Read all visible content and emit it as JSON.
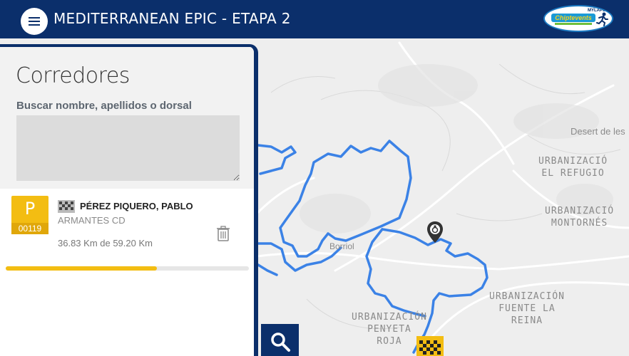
{
  "header": {
    "title": "MEDITERRANEAN EPIC - ETAPA 2",
    "menu_icon": "hamburger-menu-icon",
    "logo": {
      "top_text": "MYLAPS",
      "brand_text": "Chiptevents",
      "icon": "runner-icon",
      "colors": {
        "bg": "#ffffff",
        "blue": "#1b9ad6",
        "yellow": "#f4d21c",
        "green": "#6fbf3b"
      }
    }
  },
  "map": {
    "labels": [
      "Desert de les",
      "URBANIZACIÓ\nEL REFUGIO",
      "URBANIZACIÓ\nMONTORNÉS",
      "URBANIZACIÓN\nFUENTE LA\nREINA",
      "URBANIZACIÓN\nPENYETA\nROJA",
      "Borriol"
    ],
    "route_color": "#3b82e6",
    "icons": [
      "runner-location-pin-icon",
      "finish-flag-icon"
    ]
  },
  "panel": {
    "title": "Corredores",
    "search_label": "Buscar nombre, apellidos o dorsal",
    "search_value": "",
    "runners": [
      {
        "bib_letter": "P",
        "bib_number": "00119",
        "name": "PÉREZ PIQUERO, PABLO",
        "club": "ARMANTES CD",
        "distance_text": "36.83 Km de 59.20 Km",
        "progress_fraction": 0.622,
        "flag_icon": "checkered-flag-icon",
        "delete_icon": "trash-icon"
      }
    ]
  },
  "search_button_icon": "search-icon",
  "colors": {
    "header_bg": "#0b2f6b",
    "bib_yellow": "#f3bd12",
    "route_blue": "#3b82e6",
    "map_bg": "#eeeeee"
  }
}
